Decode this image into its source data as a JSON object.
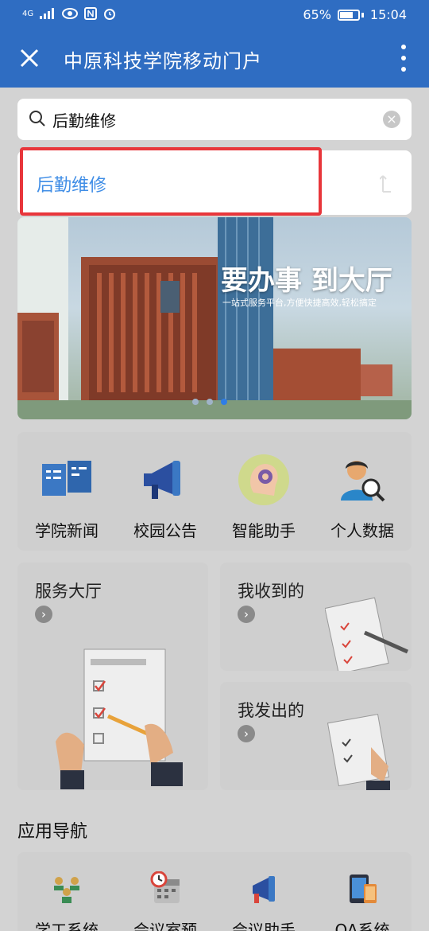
{
  "status": {
    "network": "4G",
    "battery": "65%",
    "time": "15:04"
  },
  "header": {
    "title": "中原科技学院移动门户"
  },
  "search": {
    "value": "后勤维修"
  },
  "suggestion": {
    "label": "后勤维修"
  },
  "banner": {
    "headline": "要办事 到大厅",
    "subtitle": "一站式服务平台,方便快捷高效,轻松搞定"
  },
  "quick": [
    {
      "label": "学院新闻"
    },
    {
      "label": "校园公告"
    },
    {
      "label": "智能助手"
    },
    {
      "label": "个人数据"
    }
  ],
  "cards": {
    "service_hall": "服务大厅",
    "received": "我收到的",
    "sent": "我发出的"
  },
  "nav_title": "应用导航",
  "nav": [
    {
      "label": "学工系统"
    },
    {
      "label": "会议室预"
    },
    {
      "label": "会议助手"
    },
    {
      "label": "OA系统"
    }
  ],
  "colors": {
    "header": "#2f6dc2",
    "accent": "#3f8de6",
    "highlight": "#e8363b"
  }
}
